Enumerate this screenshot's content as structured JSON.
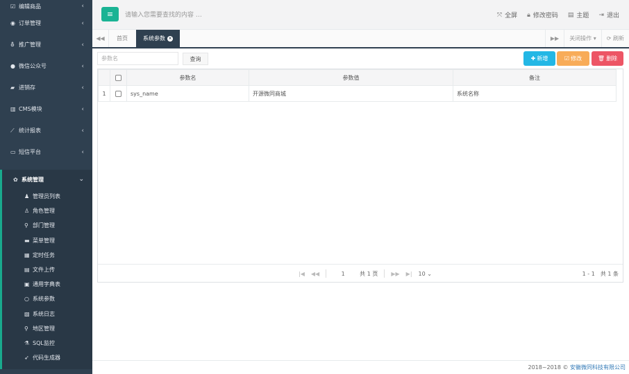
{
  "sidebar": {
    "items": [
      {
        "label": "编辑商品",
        "icon": "edit-icon",
        "glyph": "☑"
      },
      {
        "label": "订单管理",
        "icon": "order-icon",
        "glyph": "◉"
      },
      {
        "label": "推广管理",
        "icon": "promo-icon",
        "glyph": "⛢"
      },
      {
        "label": "微信公众号",
        "icon": "wechat-icon",
        "glyph": "●"
      },
      {
        "label": "进销存",
        "icon": "truck-icon",
        "glyph": "▰"
      },
      {
        "label": "CMS模块",
        "icon": "cms-icon",
        "glyph": "▥"
      },
      {
        "label": "统计报表",
        "icon": "chart-icon",
        "glyph": "⟋"
      },
      {
        "label": "短信平台",
        "icon": "monitor-icon",
        "glyph": "▭"
      }
    ],
    "active": {
      "label": "系统管理",
      "icon": "gear-icon",
      "glyph": "✿"
    },
    "sub_items": [
      {
        "label": "管理员列表",
        "icon": "user-icon",
        "glyph": "♟"
      },
      {
        "label": "角色管理",
        "icon": "role-icon",
        "glyph": "♙"
      },
      {
        "label": "部门管理",
        "icon": "sitemap-icon",
        "glyph": "⚲"
      },
      {
        "label": "菜单管理",
        "icon": "folder-icon",
        "glyph": "▬"
      },
      {
        "label": "定时任务",
        "icon": "task-icon",
        "glyph": "▦"
      },
      {
        "label": "文件上传",
        "icon": "file-icon",
        "glyph": "▤"
      },
      {
        "label": "通用字典表",
        "icon": "book-icon",
        "glyph": "▣"
      },
      {
        "label": "系统参数",
        "icon": "circle-icon",
        "glyph": "○"
      },
      {
        "label": "系统日志",
        "icon": "log-icon",
        "glyph": "▧"
      },
      {
        "label": "地区管理",
        "icon": "pin-icon",
        "glyph": "⚲"
      },
      {
        "label": "SQL监控",
        "icon": "flask-icon",
        "glyph": "⚗"
      },
      {
        "label": "代码生成器",
        "icon": "rocket-icon",
        "glyph": "➶"
      }
    ]
  },
  "topbar": {
    "menu_glyph": "≡",
    "search_placeholder": "请输入您需要查找的内容 …",
    "fullscreen": "全屏",
    "change_password": "修改密码",
    "theme": "主题",
    "logout": "退出"
  },
  "tabs": {
    "home": "首页",
    "current": "系统参数",
    "close_ops": "关闭操作",
    "refresh": "刷新"
  },
  "toolbar": {
    "param_placeholder": "参数名",
    "query": "查询",
    "add": "新增",
    "edit": "修改",
    "delete": "删除"
  },
  "table": {
    "columns": [
      "参数名",
      "参数值",
      "备注"
    ],
    "rows": [
      {
        "index": "1",
        "name": "sys_name",
        "value": "开源微同商城",
        "remark": "系统名称"
      }
    ]
  },
  "pager": {
    "page": "1",
    "total_pages": "共 1 页",
    "page_size": "10",
    "range": "1 - 1",
    "total": "共 1 条"
  },
  "footer": {
    "copyright": "2018~2018 ©",
    "company": "安徽微同科技有限公司"
  },
  "colors": {
    "sidebar": "#2f4050",
    "accent": "#1ab394",
    "add": "#23b7e5",
    "edit": "#f8ac59",
    "delete": "#ed5565"
  }
}
